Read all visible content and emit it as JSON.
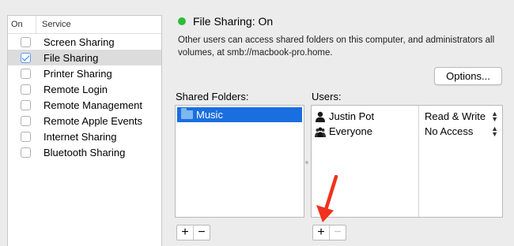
{
  "services": {
    "col_on": "On",
    "col_service": "Service",
    "items": [
      {
        "label": "Screen Sharing",
        "checked": false,
        "selected": false
      },
      {
        "label": "File Sharing",
        "checked": true,
        "selected": true
      },
      {
        "label": "Printer Sharing",
        "checked": false,
        "selected": false
      },
      {
        "label": "Remote Login",
        "checked": false,
        "selected": false
      },
      {
        "label": "Remote Management",
        "checked": false,
        "selected": false
      },
      {
        "label": "Remote Apple Events",
        "checked": false,
        "selected": false
      },
      {
        "label": "Internet Sharing",
        "checked": false,
        "selected": false
      },
      {
        "label": "Bluetooth Sharing",
        "checked": false,
        "selected": false
      }
    ]
  },
  "status": {
    "title": "File Sharing: On",
    "color": "#2dbd3a",
    "description": "Other users can access shared folders on this computer, and administrators all volumes, at smb://macbook-pro.home."
  },
  "options_button": "Options...",
  "shared_folders": {
    "label": "Shared Folders:",
    "items": [
      "Music"
    ],
    "add": "+",
    "remove": "−"
  },
  "users": {
    "label": "Users:",
    "items": [
      {
        "name": "Justin Pot",
        "icon": "single-user-icon",
        "permission": "Read & Write"
      },
      {
        "name": "Everyone",
        "icon": "group-users-icon",
        "permission": "No Access"
      }
    ],
    "add": "+",
    "remove": "−"
  },
  "colors": {
    "selection": "#1a6ee0",
    "arrow": "#f0321e"
  }
}
